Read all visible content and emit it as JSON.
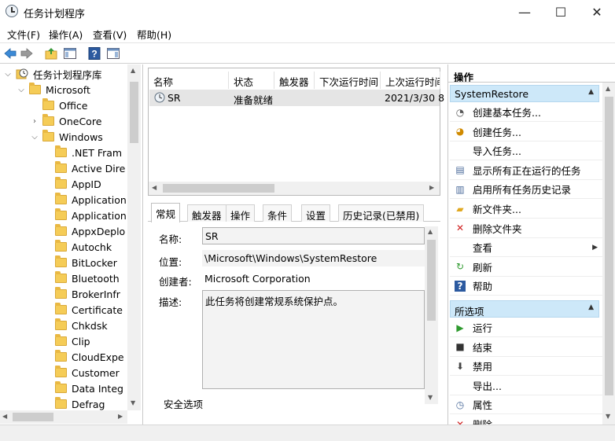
{
  "window": {
    "title": "任务计划程序",
    "minimize_glyph": "—",
    "maximize_glyph": "☐",
    "close_glyph": "✕"
  },
  "menubar": {
    "items": [
      "文件(F)",
      "操作(A)",
      "查看(V)",
      "帮助(H)"
    ]
  },
  "toolbar": {
    "icons": [
      "back-arrow-icon",
      "forward-arrow-icon",
      "up-folder-icon",
      "show-hide-tree-icon",
      "help-icon",
      "show-hide-action-pane-icon"
    ]
  },
  "tree": {
    "root": "任务计划程序库",
    "microsoft": "Microsoft",
    "office": "Office",
    "onecore": "OneCore",
    "windows": "Windows",
    "children": [
      ".NET Fram",
      "Active Dire",
      "AppID",
      "Application",
      "Application",
      "AppxDeplo",
      "Autochk",
      "BitLocker",
      "Bluetooth",
      "BrokerInfr",
      "Certificate",
      "Chkdsk",
      "Clip",
      "CloudExpe",
      "Customer",
      "Data Integ",
      "Defrag"
    ]
  },
  "tasklist": {
    "columns": [
      "名称",
      "状态",
      "触发器",
      "下次运行时间",
      "上次运行时间"
    ],
    "rows": [
      {
        "name": "SR",
        "status": "准备就绪",
        "trigger": "",
        "next_run": "",
        "last_run": "2021/3/30 8"
      }
    ]
  },
  "tabs": [
    "常规",
    "触发器",
    "操作",
    "条件",
    "设置",
    "历史记录(已禁用)"
  ],
  "general": {
    "name_label": "名称:",
    "name_value": "SR",
    "location_label": "位置:",
    "location_value": "\\Microsoft\\Windows\\SystemRestore",
    "author_label": "创建者:",
    "author_value": "Microsoft Corporation",
    "desc_label": "描述:",
    "desc_value": "此任务将创建常规系统保护点。",
    "security_label": "安全选项"
  },
  "actions": {
    "header": "操作",
    "section1": "SystemRestore",
    "section1_items": [
      {
        "label": "创建基本任务...",
        "icon": "basic-task-icon"
      },
      {
        "label": "创建任务...",
        "icon": "create-task-icon"
      },
      {
        "label": "导入任务...",
        "icon": ""
      },
      {
        "label": "显示所有正在运行的任务",
        "icon": "running-tasks-icon"
      },
      {
        "label": "启用所有任务历史记录",
        "icon": "history-icon"
      },
      {
        "label": "新文件夹...",
        "icon": "new-folder-icon"
      },
      {
        "label": "删除文件夹",
        "icon": "delete-icon"
      },
      {
        "label": "查看",
        "icon": ""
      },
      {
        "label": "刷新",
        "icon": "refresh-icon"
      },
      {
        "label": "帮助",
        "icon": "help-icon"
      }
    ],
    "section2": "所选项",
    "section2_items": [
      {
        "label": "运行",
        "icon": "run-icon"
      },
      {
        "label": "结束",
        "icon": "end-icon"
      },
      {
        "label": "禁用",
        "icon": "disable-icon"
      },
      {
        "label": "导出...",
        "icon": ""
      },
      {
        "label": "属性",
        "icon": "properties-icon"
      },
      {
        "label": "删除",
        "icon": "delete-icon"
      }
    ]
  },
  "colors": {
    "section_header_bg": "#cde8f9",
    "selected_row_bg": "#e5e5e5",
    "folder": "#f5cc57"
  }
}
